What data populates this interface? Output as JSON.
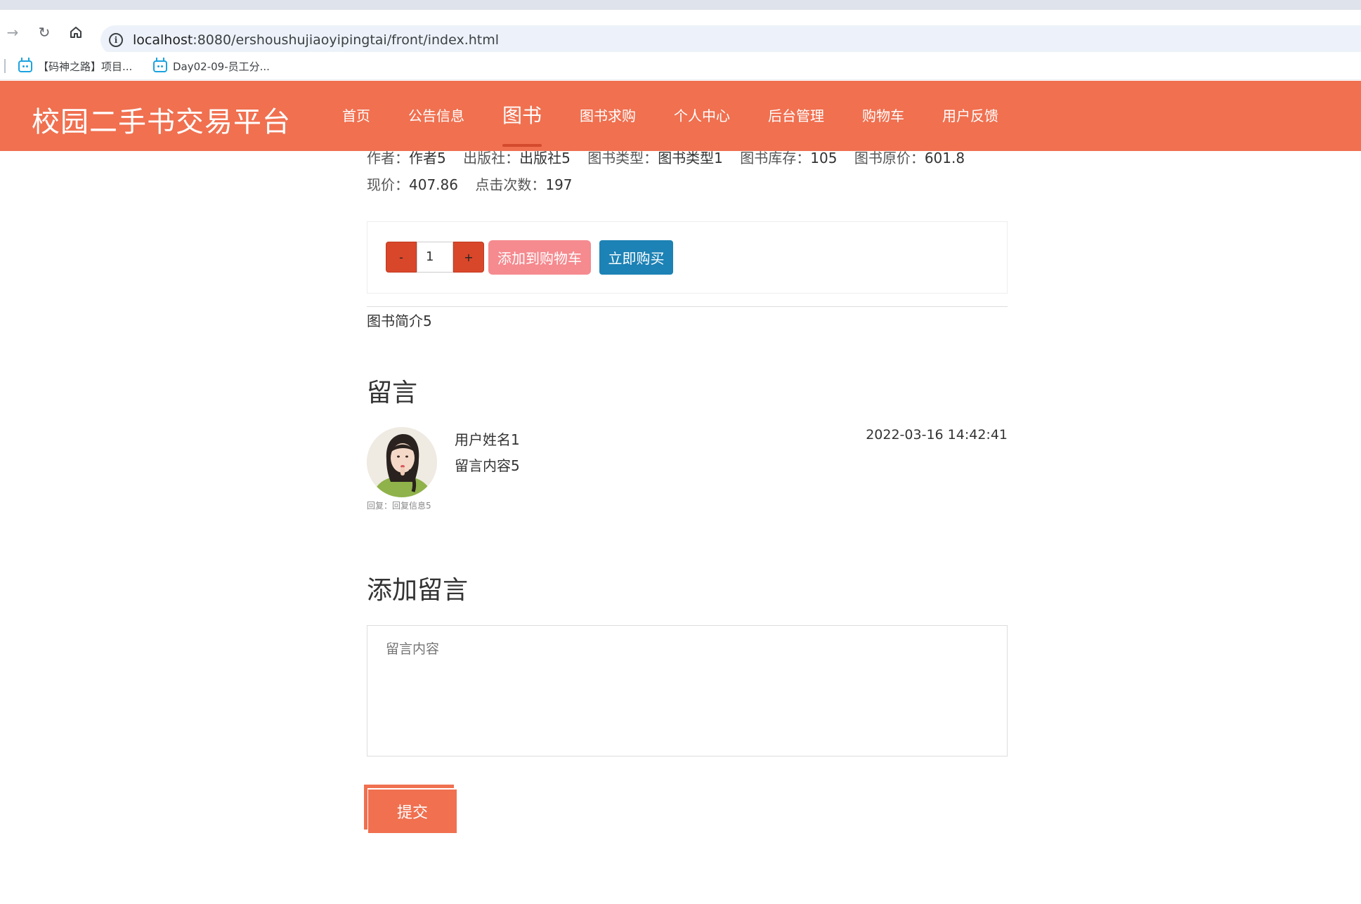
{
  "browser": {
    "url_host": "localhost",
    "url_rest": ":8080/ershoushujiaoyipingtai/front/index.html",
    "bookmarks": [
      {
        "label": "【码神之路】项目..."
      },
      {
        "label": "Day02-09-员工分..."
      }
    ]
  },
  "header": {
    "site_title": "校园二手书交易平台",
    "nav": [
      {
        "label": "首页"
      },
      {
        "label": "公告信息"
      },
      {
        "label": "图书"
      },
      {
        "label": "图书求购"
      },
      {
        "label": "个人中心"
      },
      {
        "label": "后台管理"
      },
      {
        "label": "购物车"
      },
      {
        "label": "用户反馈"
      }
    ],
    "active_nav": "图书",
    "accent_color": "#f07050"
  },
  "book": {
    "author_label": "作者：",
    "author": "作者5",
    "publisher_label": "出版社：",
    "publisher": "出版社5",
    "type_label": "图书类型：",
    "type": "图书类型1",
    "stock_label": "图书库存：",
    "stock": "105",
    "original_price_label": "图书原价：",
    "original_price": "601.8",
    "price_label": "现价：",
    "price": "407.86",
    "clicks_label": "点击次数：",
    "clicks": "197",
    "intro": "图书简介5"
  },
  "purchase": {
    "minus_label": "-",
    "quantity": "1",
    "plus_label": "+",
    "add_to_cart_label": "添加到购物车",
    "buy_now_label": "立即购买"
  },
  "comments": {
    "title": "留言",
    "items": [
      {
        "user": "用户姓名1",
        "content": "留言内容5",
        "time": "2022-03-16 14:42:41",
        "reply": "回复：回复信息5"
      }
    ]
  },
  "add_comment": {
    "title": "添加留言",
    "placeholder": "留言内容",
    "submit_label": "提交"
  }
}
